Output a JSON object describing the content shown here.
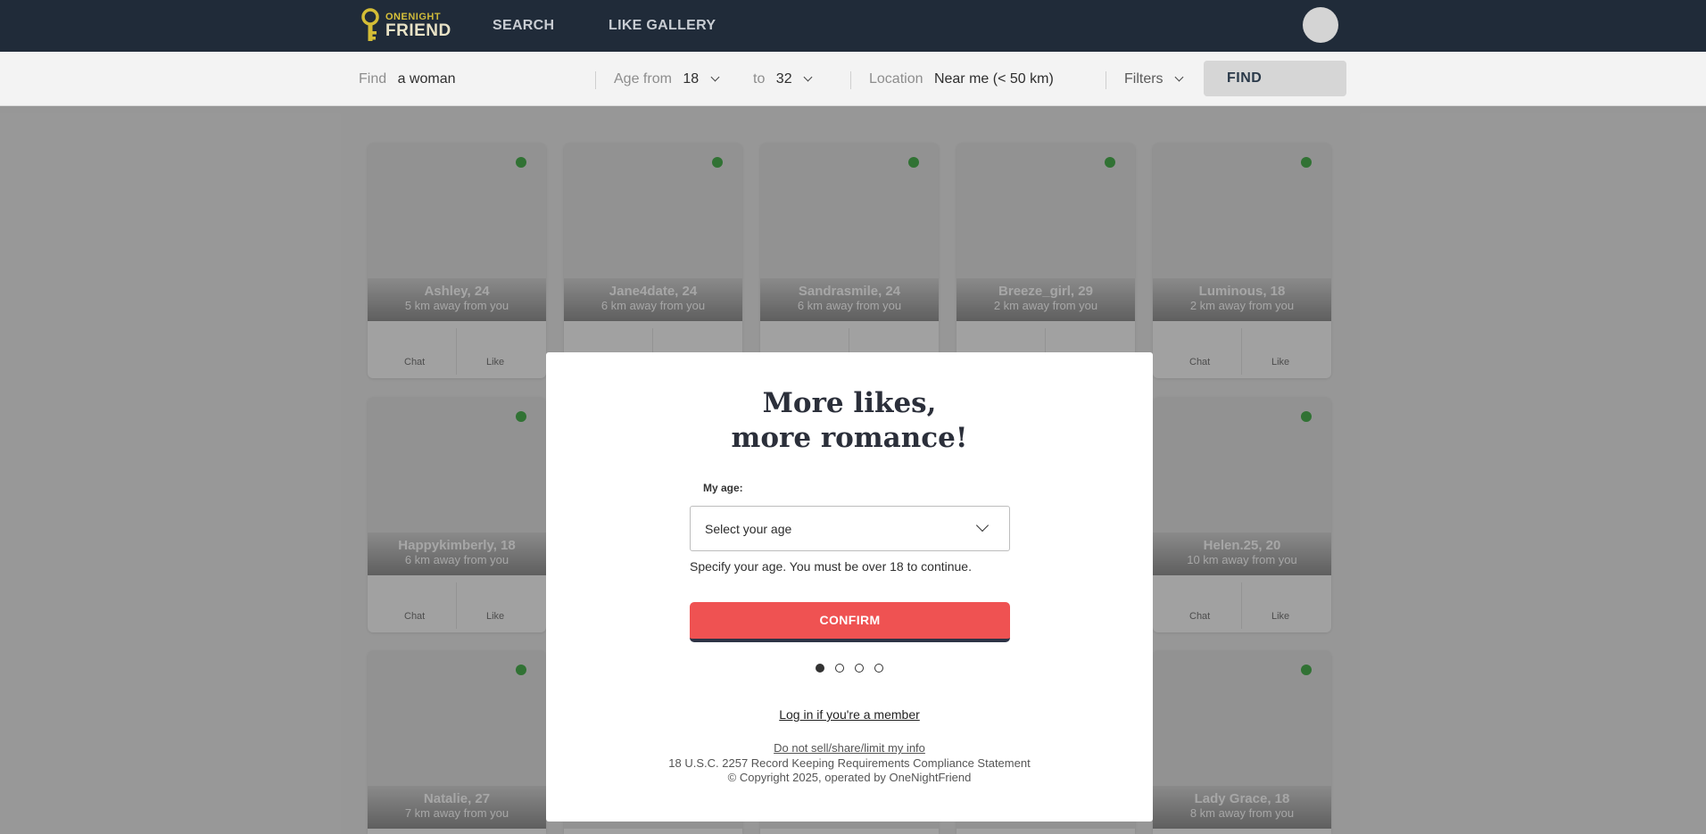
{
  "brand": {
    "top": "ONE",
    "top_accent": "NIGHT",
    "bottom": "FRIEND"
  },
  "nav": {
    "search": "SEARCH",
    "like_gallery": "LIKE GALLERY"
  },
  "search": {
    "find_label": "Find",
    "find_value": "a woman",
    "age_from_label": "Age from",
    "age_from_value": "18",
    "age_to_label": "to",
    "age_to_value": "32",
    "location_label": "Location",
    "location_value": "Near me (< 50 km)",
    "filters_label": "Filters",
    "find_button": "FIND"
  },
  "card_actions": {
    "chat": "Chat",
    "like": "Like"
  },
  "profiles": [
    {
      "name": "Ashley, 24",
      "distance": "5 km away from you"
    },
    {
      "name": "Jane4date, 24",
      "distance": "6 km away from you"
    },
    {
      "name": "Sandrasmile, 24",
      "distance": "6 km away from you"
    },
    {
      "name": "Breeze_girl, 29",
      "distance": "2 km away from you"
    },
    {
      "name": "Luminous, 18",
      "distance": "2 km away from you"
    },
    {
      "name": "Happykimberly, 18",
      "distance": "6 km away from you"
    },
    {
      "name": "Helen.25, 20",
      "distance": "10 km away from you"
    },
    {
      "name": "Natalie, 27",
      "distance": "7 km away from you"
    },
    {
      "name": "Lady Grace, 18",
      "distance": "8 km away from you"
    }
  ],
  "colors": {
    "topbar": "#202b39",
    "online": "#4caf50",
    "confirm": "#ef5252"
  },
  "modal": {
    "title_line1": "More likes,",
    "title_line2": "more romance!",
    "age_label": "My age:",
    "age_placeholder": "Select your age",
    "age_help": "Specify your age. You must be over 18 to continue.",
    "confirm_button": "CONFIRM",
    "steps": {
      "current": 1,
      "total": 4
    },
    "login_link": "Log in if you're a member",
    "legal_link": "Do not sell/share/limit my info",
    "compliance": "18 U.S.C. 2257 Record Keeping Requirements Compliance Statement",
    "copyright": "© Copyright 2025, operated by OneNightFriend"
  }
}
